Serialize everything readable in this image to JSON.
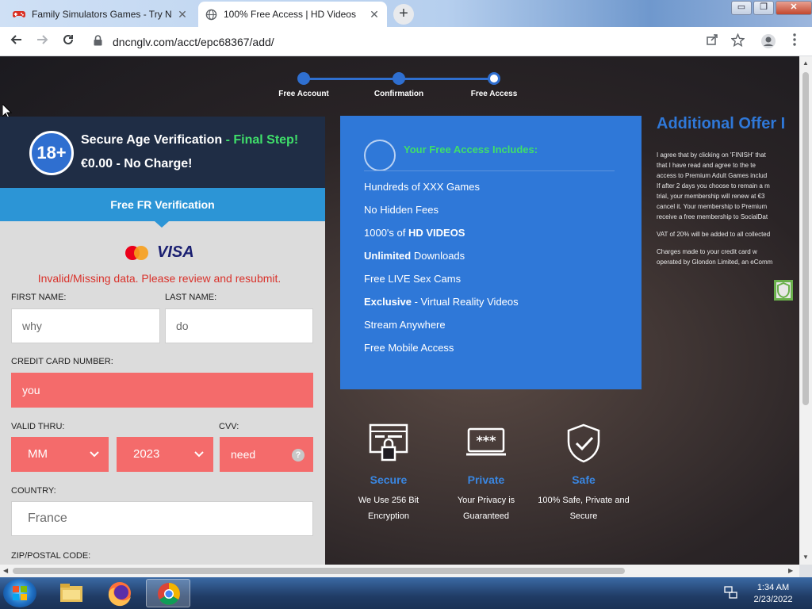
{
  "tabs": [
    {
      "title": "Family Simulators Games - Try N",
      "active": false,
      "favicon": "gamepad-icon"
    },
    {
      "title": "100% Free Access | HD Videos",
      "active": true,
      "favicon": "globe-icon"
    }
  ],
  "window_controls": {
    "minimize": "▭",
    "maximize": "❐",
    "close": "✕"
  },
  "address_bar": {
    "url": "dncnglv.com/acct/epc68367/add/"
  },
  "steps": [
    {
      "label": "Free Account",
      "state": "done"
    },
    {
      "label": "Confirmation",
      "state": "done"
    },
    {
      "label": "Free Access",
      "state": "current"
    }
  ],
  "form": {
    "badge": "18+",
    "heading": "Secure Age Verification",
    "heading_accent": " - Final Step!",
    "price_line": "€0.00 - No Charge!",
    "verification_tab": "Free FR Verification",
    "card_brand": "VISA",
    "error_message": "Invalid/Missing data. Please review and resubmit.",
    "first_name_label": "FIRST NAME:",
    "first_name_value": "why",
    "last_name_label": "LAST NAME:",
    "last_name_value": "do",
    "card_number_label": "CREDIT CARD NUMBER:",
    "card_number_value": "you",
    "valid_thru_label": "VALID THRU:",
    "month_value": "MM",
    "year_value": "2023",
    "cvv_label": "CVV:",
    "cvv_value": "need",
    "cvv_help": "?",
    "country_label": "COUNTRY:",
    "country_value": "France",
    "zip_label": "ZIP/POSTAL CODE:"
  },
  "includes": {
    "title": "Your Free Access Includes:",
    "items": [
      {
        "pre": "Hundreds of XXX Games",
        "bold": "",
        "post": ""
      },
      {
        "pre": "No Hidden Fees",
        "bold": "",
        "post": ""
      },
      {
        "pre": "1000's of ",
        "bold": "HD VIDEOS",
        "post": ""
      },
      {
        "pre": "",
        "bold": "Unlimited",
        "post": " Downloads"
      },
      {
        "pre": "Free LIVE Sex Cams",
        "bold": "",
        "post": ""
      },
      {
        "pre": "",
        "bold": "Exclusive",
        "post": " - Virtual Reality Videos"
      },
      {
        "pre": "Stream Anywhere",
        "bold": "",
        "post": ""
      },
      {
        "pre": "Free Mobile Access",
        "bold": "",
        "post": ""
      }
    ]
  },
  "features": [
    {
      "icon": "lock-icon",
      "title": "Secure",
      "line1": "We Use 256 Bit",
      "line2": "Encryption"
    },
    {
      "icon": "password-icon",
      "title": "Private",
      "line1": "Your Privacy is",
      "line2": "Guaranteed"
    },
    {
      "icon": "shield-check-icon",
      "title": "Safe",
      "line1": "100% Safe, Private and",
      "line2": "Secure"
    }
  ],
  "offer": {
    "title": "Additional Offer I",
    "lines": [
      "I agree that by clicking on 'FINISH' that",
      "that I have read and agree to the te",
      "access to Premium Adult Games includ",
      "If after 2 days you choose to remain a m",
      "trial, your membership will renew at €3",
      "cancel it. Your membership to Premium",
      "receive a free membership to SocialDat"
    ],
    "vat": "VAT of 20% will be added to all collected",
    "charges1": "Charges made to your credit card w",
    "charges2": "operated by Glondon Limited, an eComm"
  },
  "taskbar": {
    "apps": [
      "start-orb-icon",
      "file-explorer-icon",
      "firefox-icon",
      "chrome-icon"
    ],
    "time": "1:34 AM",
    "date": "2/23/2022"
  },
  "colors": {
    "accent_blue": "#2f78d8",
    "error_red": "#f46b6b",
    "green": "#3fdf6a",
    "header_navy": "#1f2d45"
  }
}
